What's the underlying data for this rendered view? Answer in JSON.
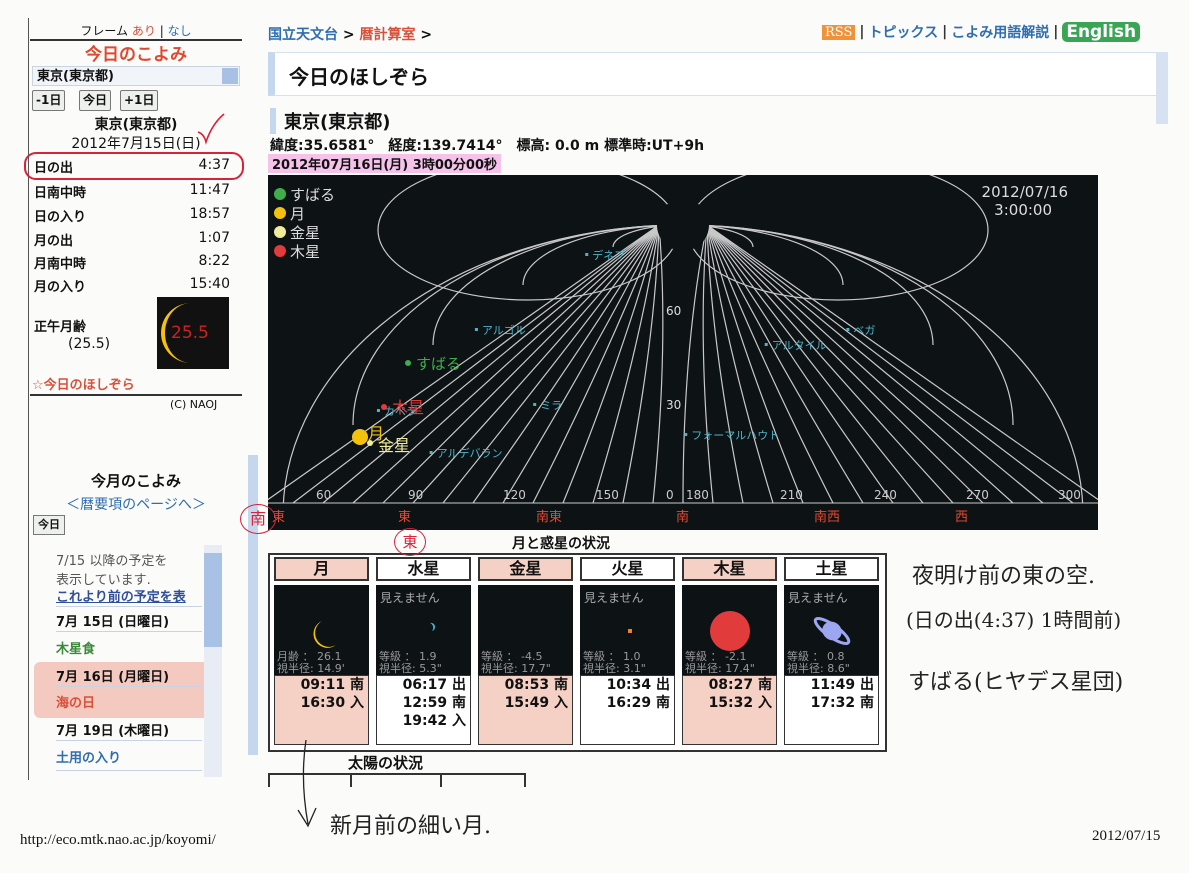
{
  "sidebar": {
    "frame_label": "フレーム",
    "frame_on": "あり",
    "frame_sep": "|",
    "frame_off": "なし",
    "title": "今日のこよみ",
    "city_select_value": "東京(東京都)",
    "buttons": {
      "prev": "-1日",
      "today": "今日",
      "next": "+1日"
    },
    "city": "東京(東京都)",
    "date": "2012年7月15日(日)",
    "rows": [
      {
        "label": "日の出",
        "value": "4:37"
      },
      {
        "label": "日南中時",
        "value": "11:47"
      },
      {
        "label": "日の入り",
        "value": "18:57"
      },
      {
        "label": "月の出",
        "value": "1:07"
      },
      {
        "label": "月南中時",
        "value": "8:22"
      },
      {
        "label": "月の入り",
        "value": "15:40"
      }
    ],
    "moon_age_label": "正午月齢",
    "moon_age_value": "(25.5)",
    "moon_age_image_text": "25.5",
    "star_link": "☆今日のほしぞら",
    "copyright": "(C) NAOJ",
    "month_title": "今月のこよみ",
    "month_link": "＜暦要項のページへ＞",
    "month_today_button": "今日",
    "schedule_note_line1": "7/15 以降の予定を",
    "schedule_note_line2": "表示しています.",
    "schedule_prev_link": "これより前の予定を表",
    "schedule": [
      {
        "date": "7月 15日 (日曜日)",
        "event": "木星食",
        "event_color": "#3a8a3a"
      },
      {
        "date": "7月 16日 (月曜日)",
        "event": "海の日",
        "event_color": "#d9503a"
      },
      {
        "date": "7月 19日 (木曜日)",
        "event": "土用の入り",
        "event_color": "#2f6db0"
      }
    ]
  },
  "header": {
    "breadcrumb": [
      "国立天文台",
      "暦計算室"
    ],
    "breadcrumb_sep": ">",
    "rss": "RSS",
    "nav": [
      "トピックス",
      "こよみ用語解説"
    ],
    "english": "English",
    "page_title": "今日のほしぞら"
  },
  "location": {
    "name": "東京(東京都)",
    "coords": "緯度:35.6581°　経度:139.7414°　標高: 0.0 m 標準時:UT+9h",
    "datetime": "2012年07月16日(月) 3時00分00秒"
  },
  "skymap": {
    "timestamp_date": "2012/07/16",
    "timestamp_time": "3:00:00",
    "legend": [
      {
        "label": "すばる",
        "color": "#3fae4a"
      },
      {
        "label": "月",
        "color": "#f4c20d"
      },
      {
        "label": "金星",
        "color": "#f0ec9a"
      },
      {
        "label": "木星",
        "color": "#e23b3b"
      }
    ],
    "stars": [
      {
        "name": "デネブ",
        "az": 52,
        "alt": 80
      },
      {
        "name": "アルゴル",
        "az": 40,
        "alt": 55
      },
      {
        "name": "ベガ",
        "az": 290,
        "alt": 55
      },
      {
        "name": "カペラ",
        "az": 45,
        "alt": 28
      },
      {
        "name": "アルタイル",
        "az": 230,
        "alt": 50
      },
      {
        "name": "ミラ",
        "az": 112,
        "alt": 30
      },
      {
        "name": "アルデバラン",
        "az": 85,
        "alt": 14
      },
      {
        "name": "フォーマルハウト",
        "az": 180,
        "alt": 20
      }
    ],
    "objects": [
      {
        "name": "すばる",
        "color": "#3fae4a"
      },
      {
        "name": "木星",
        "color": "#e23b3b"
      },
      {
        "name": "月",
        "color": "#f4c20d"
      },
      {
        "name": "金星",
        "color": "#f0ec9a"
      }
    ],
    "alt_labels": [
      "60",
      "30"
    ],
    "az_labels": [
      "60",
      "90",
      "120",
      "150",
      "0",
      "180",
      "210",
      "240",
      "270",
      "300"
    ],
    "directions": [
      "東",
      "東",
      "南東",
      "南",
      "南西",
      "西"
    ]
  },
  "planets": {
    "title": "月と惑星の状況",
    "not_visible": "見えません",
    "items": [
      {
        "name": "月",
        "highlight": true,
        "visible": true,
        "stat1": "月齢 ： 26.1",
        "stat2": "視半径: 14.9'",
        "times": [
          "09:11 南",
          "16:30 入"
        ]
      },
      {
        "name": "水星",
        "highlight": false,
        "visible": false,
        "stat1": "等級 ： 1.9",
        "stat2": "視半径: 5.3\"",
        "times": [
          "06:17 出",
          "12:59 南",
          "19:42 入"
        ]
      },
      {
        "name": "金星",
        "highlight": true,
        "visible": true,
        "stat1": "等級 ： -4.5",
        "stat2": "視半径: 17.7\"",
        "times": [
          "08:53 南",
          "15:49 入"
        ]
      },
      {
        "name": "火星",
        "highlight": false,
        "visible": false,
        "stat1": "等級 ： 1.0",
        "stat2": "視半径: 3.1\"",
        "times": [
          "10:34 出",
          "16:29 南"
        ]
      },
      {
        "name": "木星",
        "highlight": true,
        "visible": true,
        "stat1": "等級 ： -2.1",
        "stat2": "視半径: 17.4\"",
        "times": [
          "08:27 南",
          "15:32 入"
        ]
      },
      {
        "name": "土星",
        "highlight": false,
        "visible": false,
        "stat1": "等級 ： 0.8",
        "stat2": "視半径: 8.6\"",
        "times": [
          "11:49 出",
          "17:32 南"
        ]
      }
    ]
  },
  "sun": {
    "title": "太陽の状況"
  },
  "annotations": {
    "note1": "夜明け前の東の空.",
    "note2": "(日の出(4:37) 1時間前)",
    "note3": "すばる(ヒヤデス星団)",
    "note4": "新月前の細い月.",
    "circle_south": "南",
    "circle_east": "東"
  },
  "footer": {
    "url": "http://eco.mtk.nao.ac.jp/koyomi/",
    "date": "2012/07/15"
  }
}
